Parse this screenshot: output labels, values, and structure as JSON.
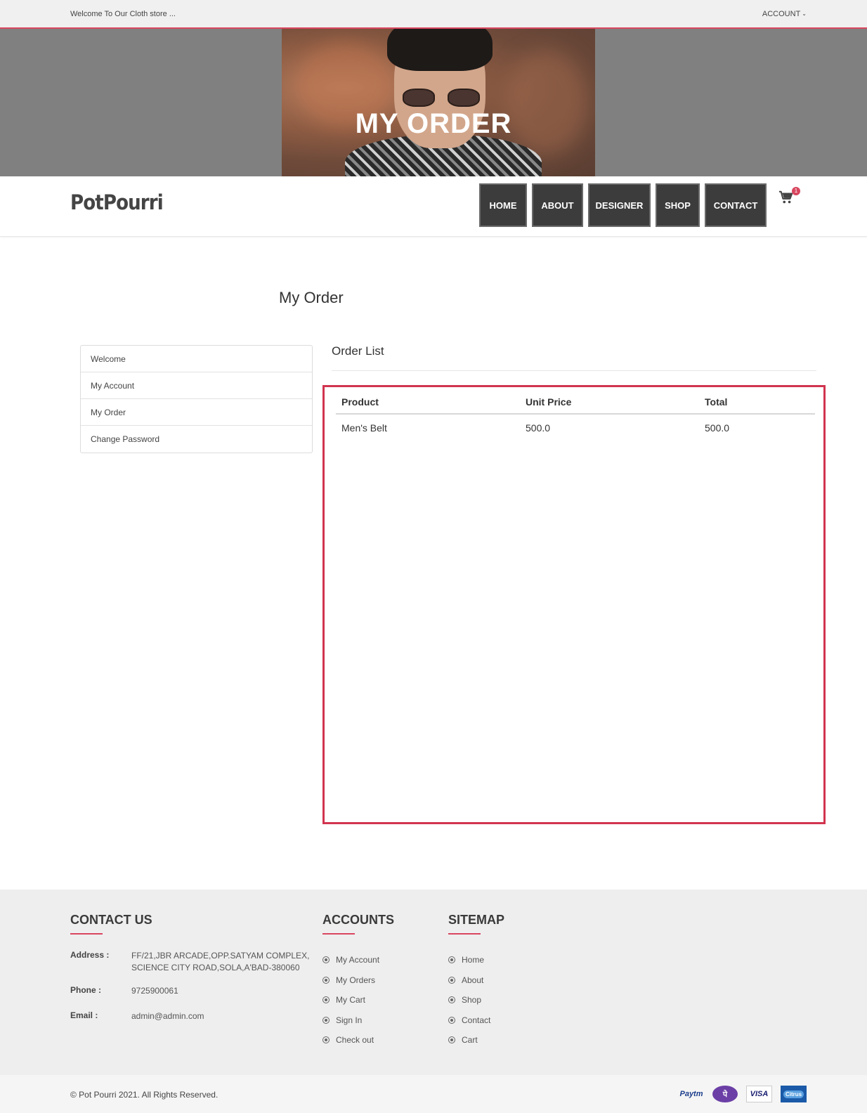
{
  "topbar": {
    "welcome": "Welcome To Our Cloth store ...",
    "account": "ACCOUNT"
  },
  "hero": {
    "title": "MY ORDER"
  },
  "header": {
    "logo": "PotPourri",
    "menu": [
      "HOME",
      "ABOUT",
      "DESIGNER",
      "SHOP",
      "CONTACT"
    ],
    "cart_count": "1"
  },
  "main": {
    "title": "My Order",
    "sidebar": [
      "Welcome",
      "My Account",
      "My Order",
      "Change Password"
    ],
    "order_list_title": "Order List",
    "table": {
      "headers": [
        "Product",
        "Unit Price",
        "Total"
      ],
      "rows": [
        [
          "Men's Belt",
          "500.0",
          "500.0"
        ]
      ]
    }
  },
  "footer": {
    "contact": {
      "title": "CONTACT US",
      "address_label": "Address :",
      "address_line1": "FF/21,JBR ARCADE,OPP.SATYAM COMPLEX,",
      "address_line2": "SCIENCE CITY ROAD,SOLA,A'BAD-380060",
      "phone_label": "Phone :",
      "phone": "9725900061",
      "email_label": "Email :",
      "email": "admin@admin.com"
    },
    "accounts": {
      "title": "ACCOUNTS",
      "links": [
        "My Account",
        "My Orders",
        "My Cart",
        "Sign In",
        "Check out"
      ]
    },
    "sitemap": {
      "title": "SITEMAP",
      "links": [
        "Home",
        "About",
        "Shop",
        "Contact",
        "Cart"
      ]
    },
    "copyright": "© Pot Pourri 2021. All Rights Reserved.",
    "payments": [
      "Paytm",
      "PhonePe",
      "VISA",
      "Citrus"
    ]
  },
  "colors": {
    "accent": "#d9465f",
    "nav_bg": "#3c3c3c",
    "footer_bg": "#eeeeef"
  }
}
